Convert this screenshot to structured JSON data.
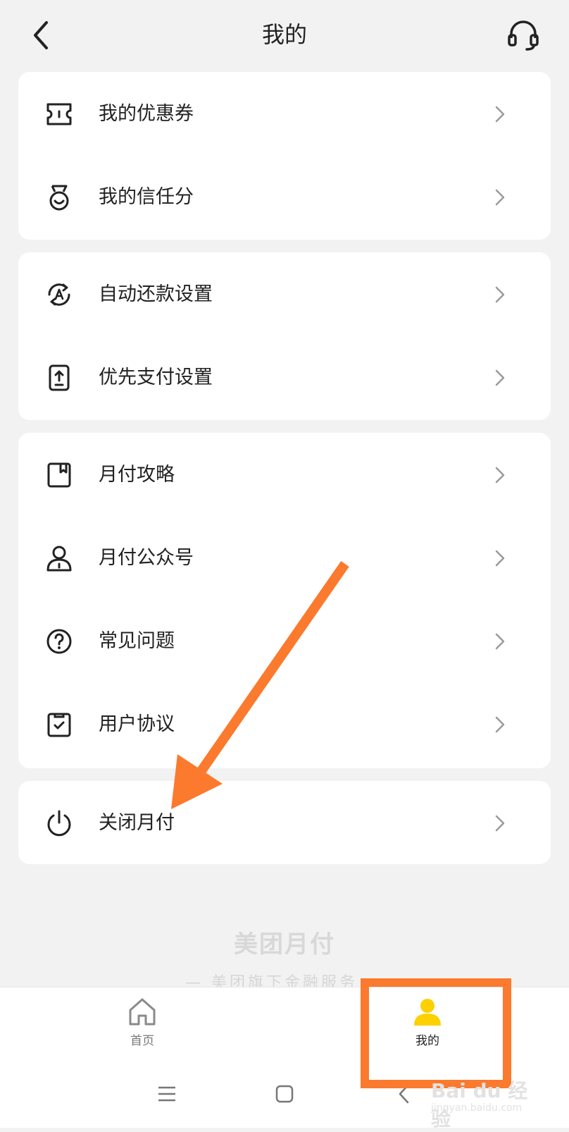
{
  "header": {
    "title": "我的",
    "back_icon": "chevron-left-icon",
    "service_icon": "headset-icon"
  },
  "cards": [
    {
      "items": [
        {
          "label": "我的优惠券",
          "icon": "coupon-icon"
        },
        {
          "label": "我的信任分",
          "icon": "medal-icon"
        }
      ]
    },
    {
      "items": [
        {
          "label": "自动还款设置",
          "icon": "auto-repay-icon"
        },
        {
          "label": "优先支付设置",
          "icon": "priority-pay-icon"
        }
      ]
    },
    {
      "items": [
        {
          "label": "月付攻略",
          "icon": "bookmark-icon"
        },
        {
          "label": "月付公众号",
          "icon": "person-icon"
        },
        {
          "label": "常见问题",
          "icon": "question-icon"
        },
        {
          "label": "用户协议",
          "icon": "clipboard-check-icon"
        }
      ]
    },
    {
      "items": [
        {
          "label": "关闭月付",
          "icon": "power-icon"
        }
      ]
    }
  ],
  "footer": {
    "brand": "美团月付",
    "subtitle": "— 美团旗下金融服务 —"
  },
  "tabbar": {
    "tabs": [
      {
        "label": "首页",
        "icon": "home-icon",
        "active": false
      },
      {
        "label": "我的",
        "icon": "profile-icon",
        "active": true
      }
    ]
  },
  "watermark": {
    "logo": "Bai du 经验",
    "url": "jingyan.baidu.com"
  },
  "colors": {
    "accent": "#fb7a2d",
    "active_tab": "#fdd000",
    "text": "#222222",
    "background": "#f2f2f2"
  }
}
